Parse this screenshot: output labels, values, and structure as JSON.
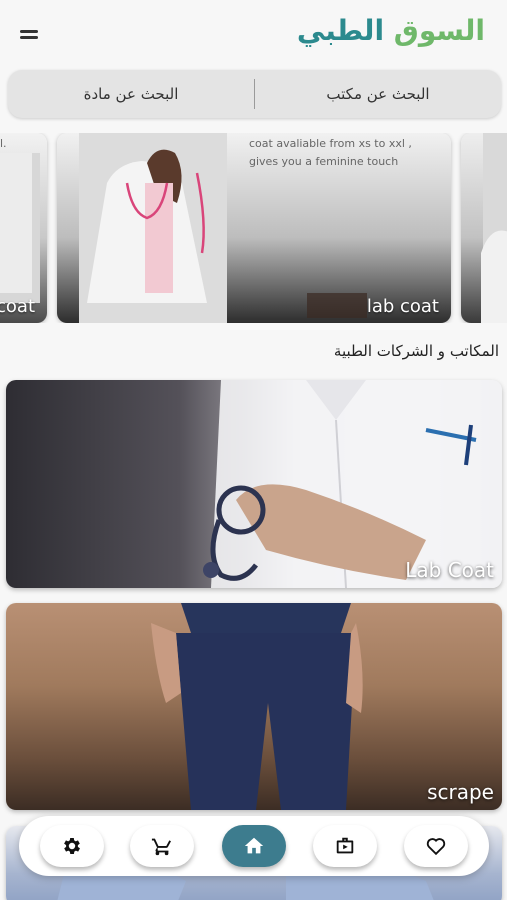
{
  "header": {
    "logo_word_green": "السوق",
    "logo_word_teal": "الطبي"
  },
  "search": {
    "office_label": "البحث عن مكتب",
    "material_label": "البحث عن مادة"
  },
  "carousel": {
    "left_card_label": "coat",
    "left_card_edge_text": "l.",
    "main_card_label": "lab coat",
    "main_card_desc_line1": "coat avaliable from xs to xxl ,",
    "main_card_desc_line2": "gives you a feminine touch"
  },
  "section": {
    "title": "المكاتب و الشركات الطبية"
  },
  "categories": [
    {
      "label": "Lab Coat"
    },
    {
      "label": "scrape"
    },
    {
      "label": ""
    }
  ],
  "bottom_nav": {
    "items": [
      {
        "icon": "gear-icon"
      },
      {
        "icon": "cart-icon"
      },
      {
        "icon": "home-icon",
        "active": true
      },
      {
        "icon": "briefcase-play-icon"
      },
      {
        "icon": "heart-icon"
      }
    ]
  },
  "colors": {
    "accent": "#3d7c8e",
    "logo_green": "#6fb86a",
    "logo_teal": "#2c8a8e"
  }
}
